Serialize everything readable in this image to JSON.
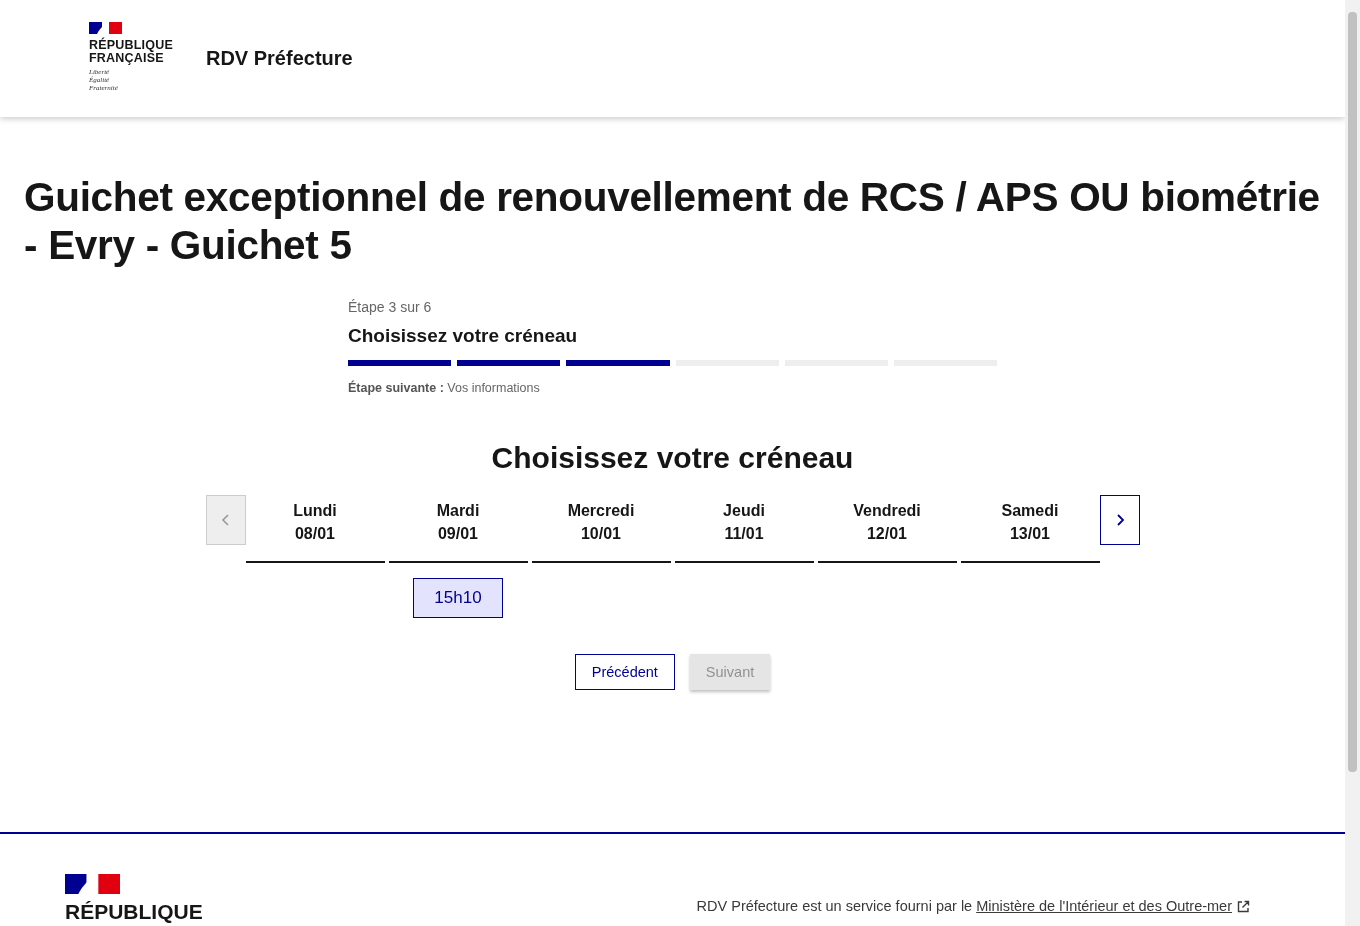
{
  "header": {
    "logo_lines": [
      "RÉPUBLIQUE",
      "FRANÇAISE"
    ],
    "motto": [
      "Liberté",
      "Égalité",
      "Fraternité"
    ],
    "service_name": "RDV Préfecture"
  },
  "title": "Guichet exceptionnel de renouvellement de RCS / APS OU biométrie - Evry - Guichet 5",
  "stepper": {
    "step_label": "Étape 3 sur 6",
    "current": "Choisissez votre créneau",
    "segments": [
      {
        "completed": true
      },
      {
        "completed": true
      },
      {
        "completed": true
      },
      {
        "completed": false
      },
      {
        "completed": false
      },
      {
        "completed": false
      }
    ],
    "next_step": "**Étape suivante :** Vos informations"
  },
  "calendar": {
    "heading": "Choisissez votre créneau",
    "prev_disabled": true,
    "next_disabled": false,
    "days": [
      {
        "name": "Lundi",
        "date": "08/01"
      },
      {
        "name": "Mardi",
        "date": "09/01",
        "slots": [
          {
            "time": "15h10",
            "selected": false
          }
        ]
      },
      {
        "name": "Mercredi",
        "date": "10/01"
      },
      {
        "name": "Jeudi",
        "date": "11/01"
      },
      {
        "name": "Vendredi",
        "date": "12/01"
      },
      {
        "name": "Samedi",
        "date": "13/01"
      }
    ]
  },
  "buttons": [
    {
      "label": "Précédent",
      "disabled": false
    },
    {
      "label": "Suivant",
      "disabled": true
    }
  ],
  "footer": {
    "logo_line": "RÉPUBLIQUE",
    "text": "RDV Préfecture est un service fourni par le",
    "link": "Ministère de l'Intérieur et des Outre-mer"
  }
}
